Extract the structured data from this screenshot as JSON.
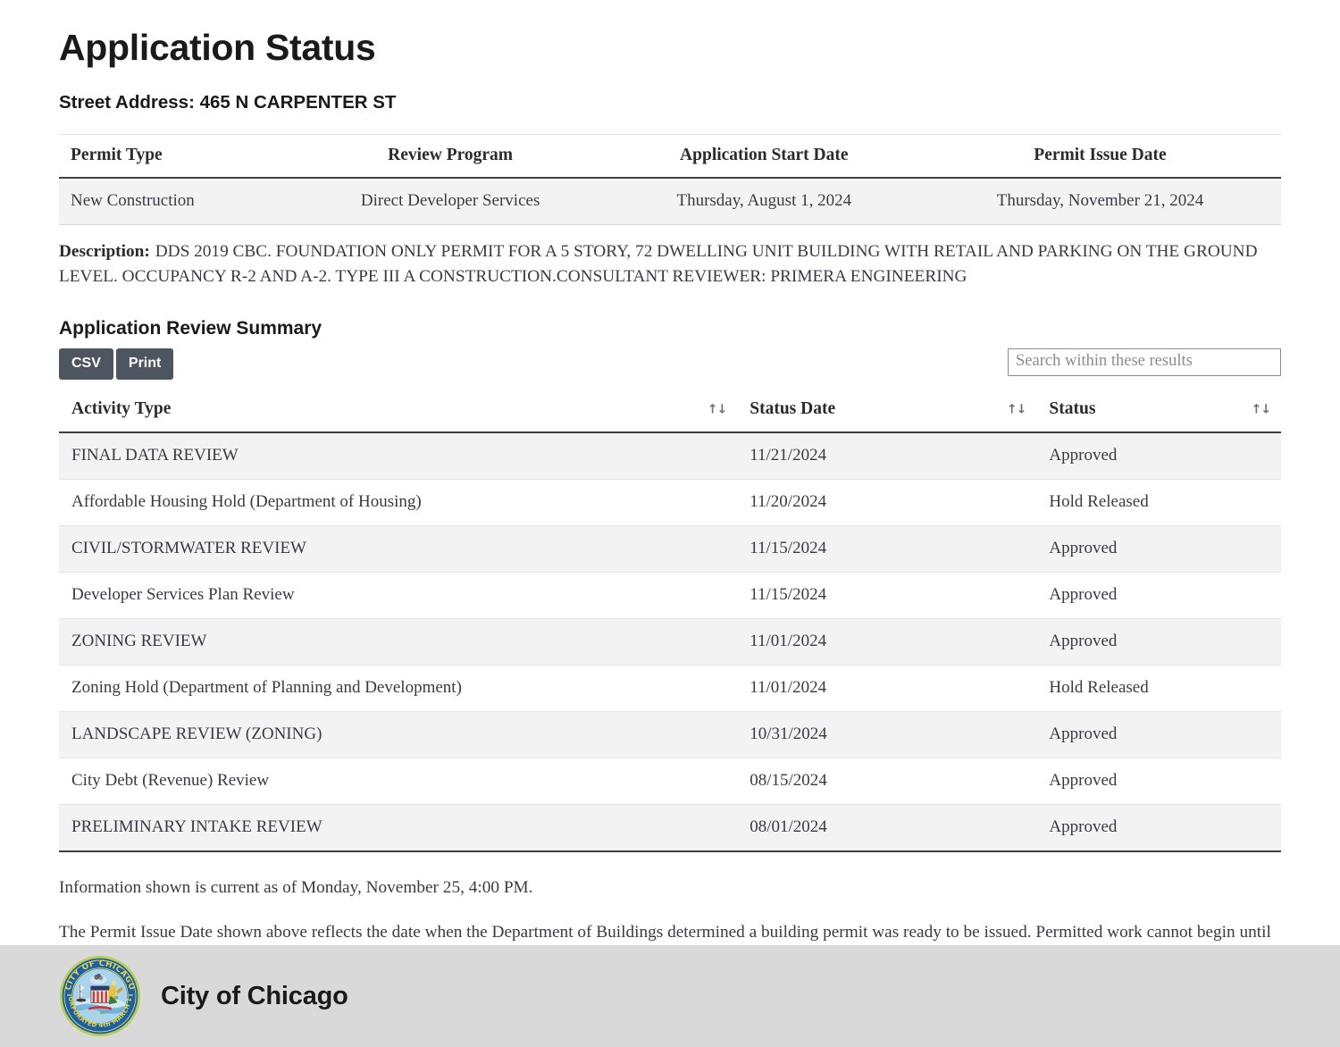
{
  "page": {
    "title": "Application Status",
    "street_address": "Street Address: 465 N CARPENTER ST"
  },
  "permit_summary": {
    "headers": [
      "Permit Type",
      "Review Program",
      "Application Start Date",
      "Permit Issue Date"
    ],
    "row": {
      "permit_type": "New Construction",
      "review_program": "Direct Developer Services",
      "application_start_date": "Thursday, August 1, 2024",
      "permit_issue_date": "Thursday, November 21, 2024"
    }
  },
  "description": {
    "label": "Description:",
    "text": "DDS 2019 CBC. FOUNDATION ONLY PERMIT FOR A 5 STORY, 72 DWELLING UNIT BUILDING WITH RETAIL AND PARKING ON THE GROUND LEVEL. OCCUPANCY R-2 AND A-2. TYPE III A CONSTRUCTION.CONSULTANT REVIEWER: PRIMERA ENGINEERING"
  },
  "review_summary": {
    "section_title": "Application Review Summary",
    "buttons": {
      "csv": "CSV",
      "print": "Print"
    },
    "search": {
      "placeholder": "Search within these results",
      "value": ""
    },
    "headers": {
      "activity_type": "Activity Type",
      "status_date": "Status Date",
      "status": "Status",
      "sort_icon": "↑↓"
    },
    "rows": [
      {
        "activity_type": "FINAL DATA REVIEW",
        "status_date": "11/21/2024",
        "status": "Approved"
      },
      {
        "activity_type": "Affordable Housing Hold (Department of Housing)",
        "status_date": "11/20/2024",
        "status": "Hold Released"
      },
      {
        "activity_type": "CIVIL/STORMWATER REVIEW",
        "status_date": "11/15/2024",
        "status": "Approved"
      },
      {
        "activity_type": "Developer Services Plan Review",
        "status_date": "11/15/2024",
        "status": "Approved"
      },
      {
        "activity_type": "ZONING REVIEW",
        "status_date": "11/01/2024",
        "status": "Approved"
      },
      {
        "activity_type": "Zoning Hold (Department of Planning and Development)",
        "status_date": "11/01/2024",
        "status": "Hold Released"
      },
      {
        "activity_type": "LANDSCAPE REVIEW (ZONING)",
        "status_date": "10/31/2024",
        "status": "Approved"
      },
      {
        "activity_type": "City Debt (Revenue) Review",
        "status_date": "08/15/2024",
        "status": "Approved"
      },
      {
        "activity_type": "PRELIMINARY INTAKE REVIEW",
        "status_date": "08/01/2024",
        "status": "Approved"
      }
    ]
  },
  "notes": {
    "currency": "Information shown is current as of Monday, November 25, 4:00 PM.",
    "permit_note": "The Permit Issue Date shown above reflects the date when the Department of Buildings determined a building permit was ready to be issued. Permitted work cannot begin until all permit fees have been paid in full."
  },
  "footer": {
    "organization": "City of Chicago",
    "seal_outer_text": "CITY OF CHICAGO",
    "seal_inner_text": "INCORPORATED 4th MARCH 1837"
  },
  "colors": {
    "button_bg": "#4c5560",
    "row_stripe": "#f3f3f3",
    "footer_bg": "#d9d9d9",
    "rule": "#3f3f3f"
  }
}
